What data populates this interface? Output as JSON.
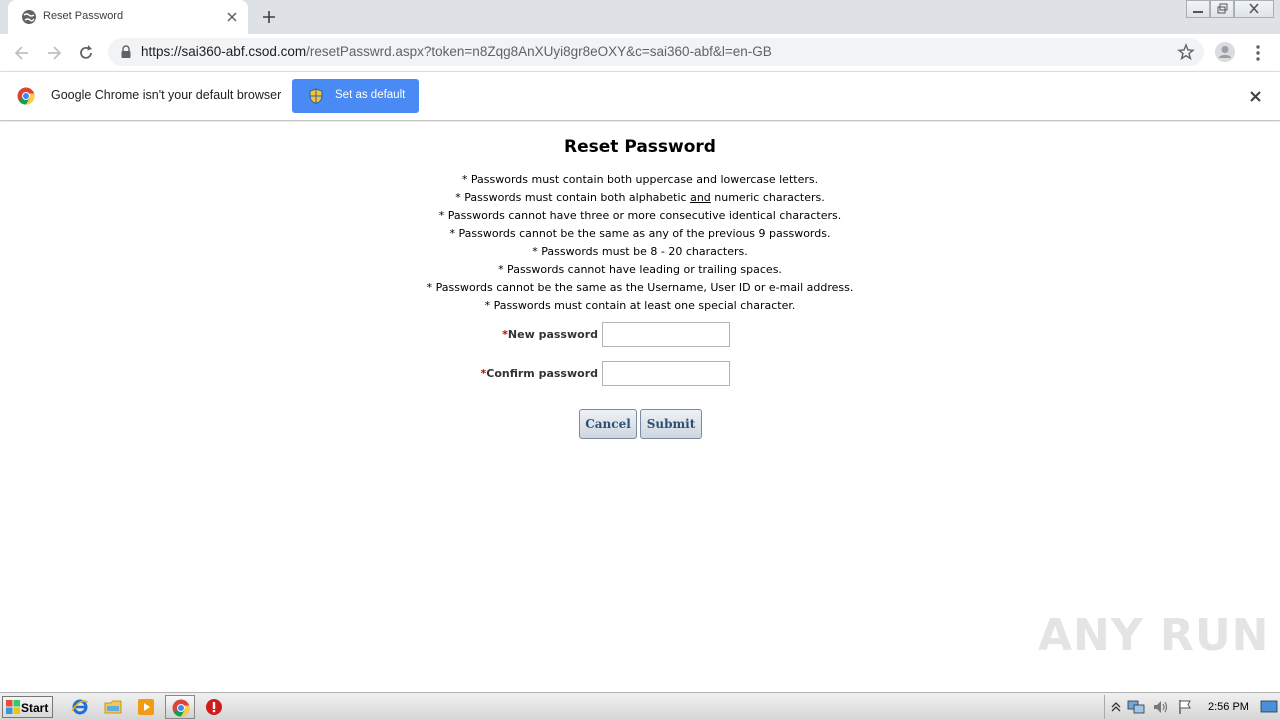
{
  "browser": {
    "tab_title": "Reset Password",
    "url_host": "https://sai360-abf.csod.com",
    "url_path": "/resetPasswrd.aspx?token=n8Zqg8AnXUyi8gr8eOXY&c=sai360-abf&l=en-GB"
  },
  "infobar": {
    "message": "Google Chrome isn't your default browser",
    "set_default_label": "Set as default"
  },
  "page": {
    "title": "Reset Password",
    "rules": [
      "* Passwords must contain both uppercase and lowercase letters.",
      "* Passwords must contain both alphabetic ",
      "* Passwords cannot have three or more consecutive identical characters.",
      "* Passwords cannot be the same as any of the previous 9 passwords.",
      "* Passwords must be 8 - 20 characters.",
      "* Passwords cannot have leading or trailing spaces.",
      "* Passwords cannot be the same as the Username, User ID or e-mail address.",
      "* Passwords must contain at least one special character."
    ],
    "rule2_underlined": "and",
    "rule2_tail": " numeric characters.",
    "required_marker": "*",
    "new_password_label": "New password",
    "new_password_value": "",
    "confirm_password_label": "Confirm password",
    "confirm_password_value": "",
    "cancel_label": "Cancel",
    "submit_label": "Submit"
  },
  "watermark": "ANY RUN",
  "taskbar": {
    "start_label": "Start",
    "clock": "2:56 PM",
    "apps": [
      "ie-icon",
      "explorer-icon",
      "media-player-icon",
      "chrome-icon",
      "stop-icon"
    ]
  },
  "colors": {
    "accent_blue": "#4a8af4",
    "required_red": "#cc0000",
    "button_text": "#2d4f73"
  }
}
